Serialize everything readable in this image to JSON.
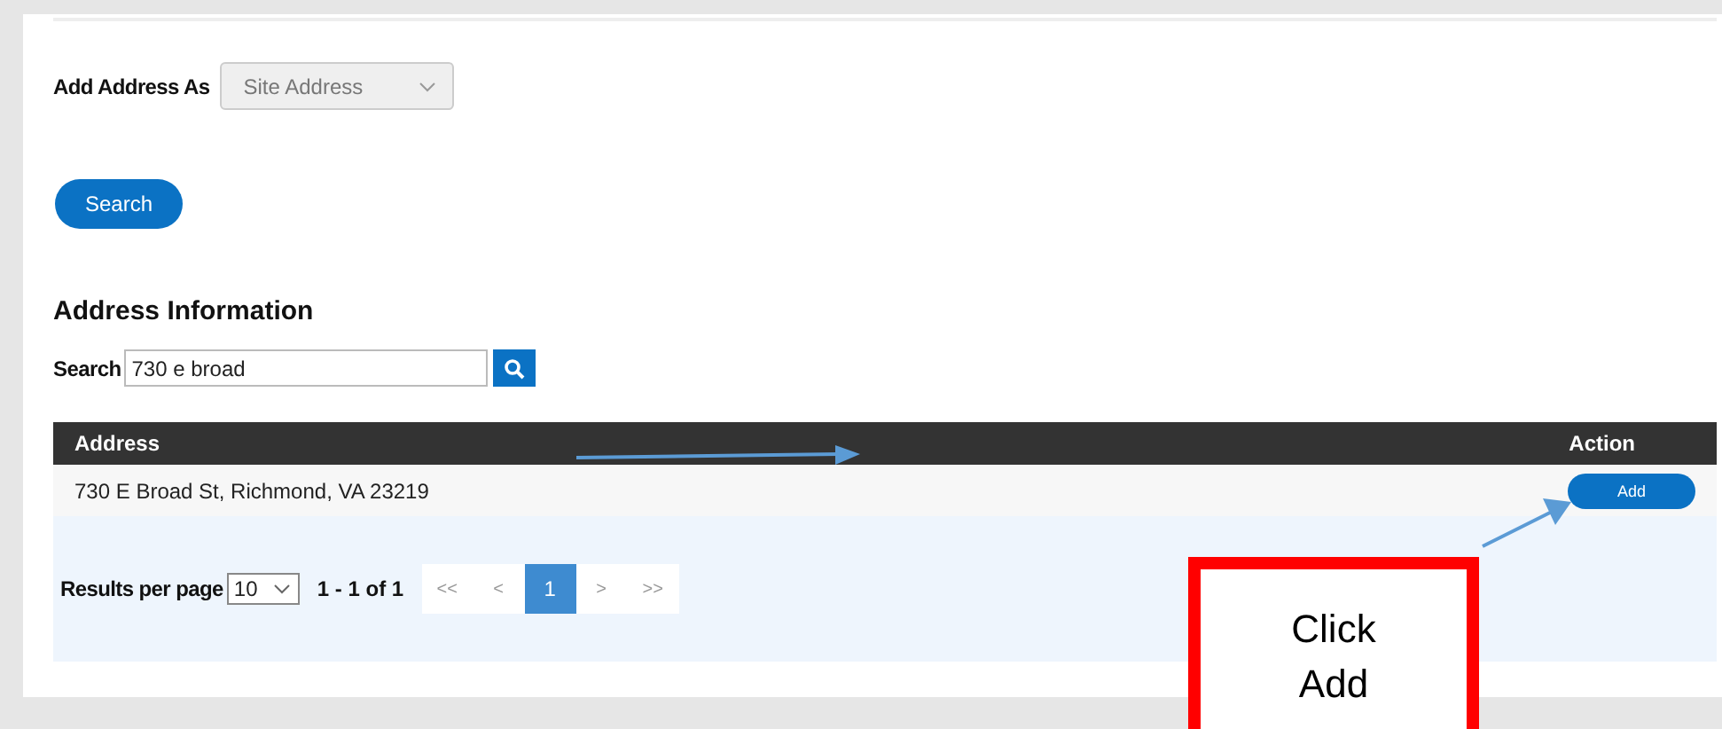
{
  "form": {
    "label": "Add Address As",
    "select_value": "Site Address",
    "search_button": "Search"
  },
  "address_information": {
    "title": "Address Information",
    "search_label": "Search",
    "search_value": "730 e broad",
    "table": {
      "columns": [
        "Address",
        "Action"
      ],
      "rows": [
        {
          "address": "730 E Broad St, Richmond, VA 23219",
          "action": "Add"
        }
      ]
    },
    "pagination": {
      "results_label": "Results per page",
      "per_page": "10",
      "range": "1 - 1 of 1",
      "pages": [
        {
          "label": "<<",
          "selected": false
        },
        {
          "label": "<",
          "selected": false
        },
        {
          "label": "1",
          "selected": true
        },
        {
          "label": ">",
          "selected": false
        },
        {
          "label": ">>",
          "selected": false
        }
      ]
    }
  },
  "callout": {
    "text": "Click Add"
  }
}
